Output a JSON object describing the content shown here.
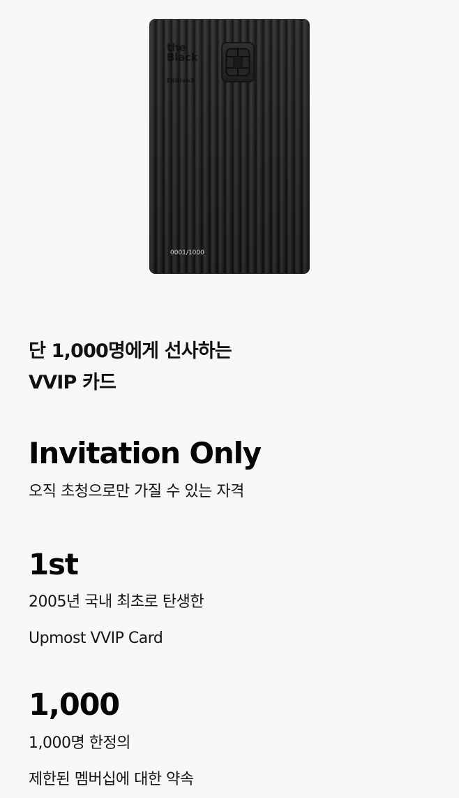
{
  "card": {
    "brand_line1": "the",
    "brand_line2": "Black",
    "edition": "Edition3",
    "serial": "0001/1000",
    "chip_icon": "chip-icon"
  },
  "headline": {
    "line1": "단 1,000명에게 선사하는",
    "line2": "VVIP 카드"
  },
  "features": [
    {
      "title": "Invitation Only",
      "description_lines": [
        "오직 초청으로만 가질 수 있는 자격"
      ]
    },
    {
      "title": "1st",
      "description_lines": [
        "2005년 국내 최초로 탄생한",
        "Upmost VVIP Card"
      ]
    },
    {
      "title": "1,000",
      "description_lines": [
        "1,000명 한정의",
        "제한된 멤버십에 대한 약속"
      ]
    }
  ],
  "colors": {
    "background": "#f6f7f9",
    "text": "#111111",
    "card": "#1c1c1c"
  }
}
